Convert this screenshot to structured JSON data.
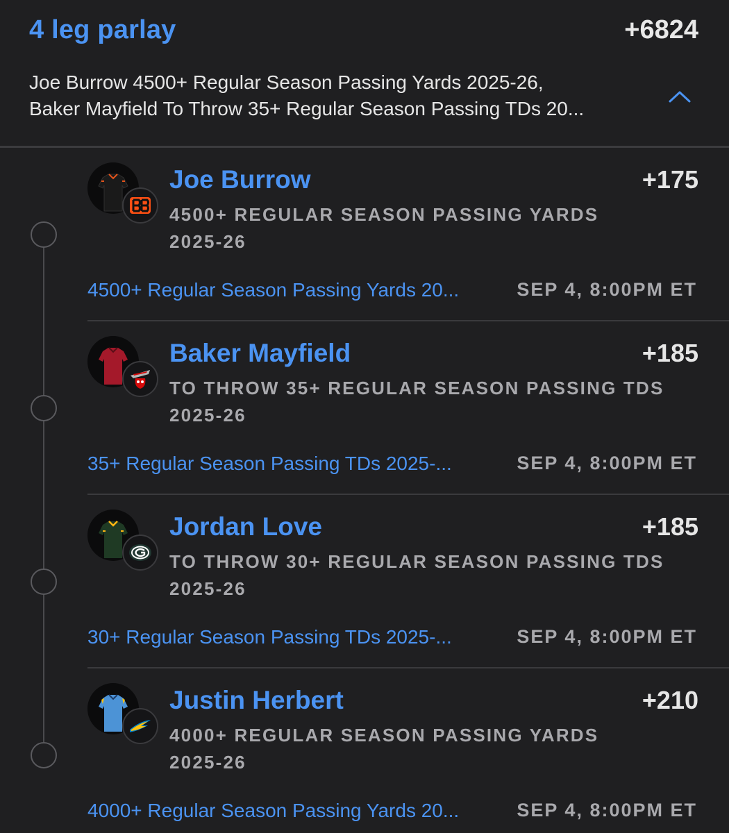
{
  "header": {
    "title": "4 leg parlay",
    "total_odds": "+6824",
    "summary_line1": "Joe Burrow 4500+ Regular Season Passing Yards 2025-26,",
    "summary_line2": "Baker Mayfield To Throw 35+ Regular Season Passing TDs 20...",
    "chevron_icon": "chevron-up-icon"
  },
  "colors": {
    "accent": "#4b93f2",
    "background": "#1f1f21",
    "muted_text": "#a9a9ad"
  },
  "legs": [
    {
      "player": "Joe Burrow",
      "odds": "+175",
      "market_line1": "4500+ REGULAR SEASON PASSING YARDS",
      "market_line2": "2025-26",
      "link": "4500+ Regular Season Passing Yards 20...",
      "datetime": "SEP 4, 8:00PM ET",
      "jersey_color": "#1a1a1a",
      "team_icon": "bengals-logo-icon"
    },
    {
      "player": "Baker Mayfield",
      "odds": "+185",
      "market_line1": "TO THROW 35+ REGULAR SEASON PASSING TDS",
      "market_line2": "2025-26",
      "link": "35+ Regular Season Passing TDs 2025-...",
      "datetime": "SEP 4, 8:00PM ET",
      "jersey_color": "#a4192a",
      "team_icon": "buccaneers-logo-icon"
    },
    {
      "player": "Jordan Love",
      "odds": "+185",
      "market_line1": "TO THROW 30+ REGULAR SEASON PASSING TDS",
      "market_line2": "2025-26",
      "link": "30+ Regular Season Passing TDs 2025-...",
      "datetime": "SEP 4, 8:00PM ET",
      "jersey_color": "#1f3a24",
      "team_icon": "packers-logo-icon"
    },
    {
      "player": "Justin Herbert",
      "odds": "+210",
      "market_line1": "4000+ REGULAR SEASON PASSING YARDS",
      "market_line2": "2025-26",
      "link": "4000+ Regular Season Passing Yards 20...",
      "datetime": "SEP 4, 8:00PM ET",
      "jersey_color": "#4c93d6",
      "team_icon": "chargers-logo-icon"
    }
  ]
}
